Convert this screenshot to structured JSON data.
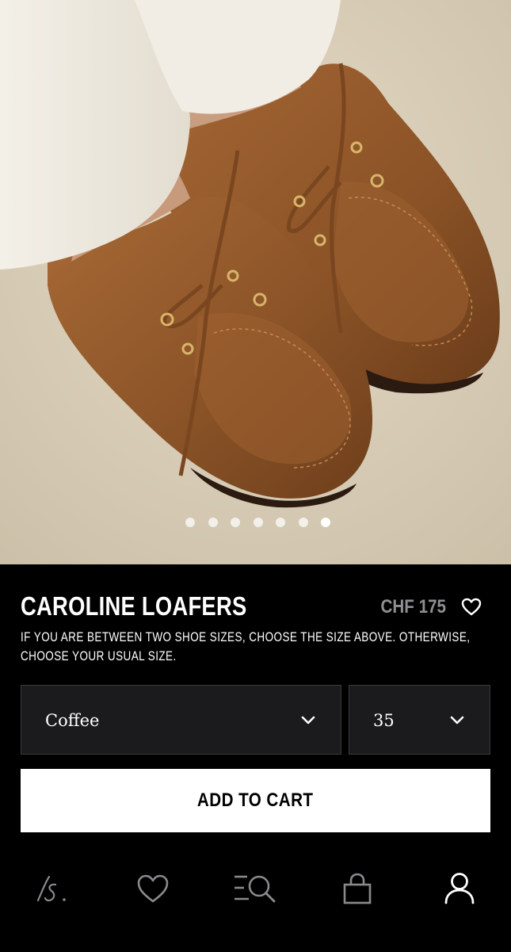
{
  "product": {
    "name": "CAROLINE LOAFERS",
    "price": "CHF 175",
    "size_note": "IF YOU ARE BETWEEN TWO SHOE SIZES, CHOOSE THE SIZE ABOVE. OTHERWISE, CHOOSE YOUR USUAL SIZE."
  },
  "gallery": {
    "total_images": 7,
    "active_index": 7
  },
  "selectors": {
    "color": {
      "selected": "Coffee"
    },
    "size": {
      "selected": "35"
    }
  },
  "actions": {
    "add_to_cart_label": "ADD TO CART"
  },
  "nav": {
    "items": [
      {
        "icon": "brand-logo-icon",
        "active": false
      },
      {
        "icon": "heart-icon",
        "active": false
      },
      {
        "icon": "search-menu-icon",
        "active": false
      },
      {
        "icon": "bag-icon",
        "active": false
      },
      {
        "icon": "account-icon",
        "active": true
      }
    ]
  },
  "colors": {
    "background": "#000000",
    "price_text": "#8f8f94",
    "select_bg": "#1b1b1d",
    "button_bg": "#ffffff",
    "nav_icon_inactive": "#8a8a8e",
    "nav_icon_active": "#ffffff"
  }
}
